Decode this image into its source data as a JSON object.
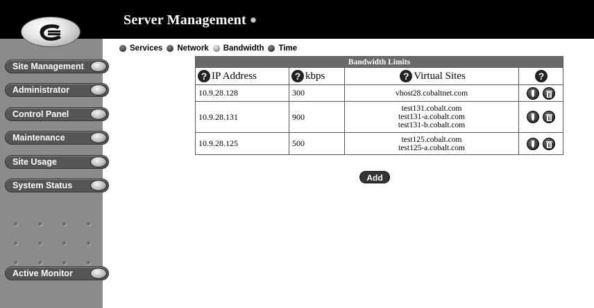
{
  "header": {
    "title": "Server Management"
  },
  "sidebar": {
    "items": [
      {
        "label": "Site Management"
      },
      {
        "label": "Administrator"
      },
      {
        "label": "Control Panel"
      },
      {
        "label": "Maintenance"
      },
      {
        "label": "Site Usage"
      },
      {
        "label": "System Status"
      },
      {
        "label": "Active Monitor"
      }
    ]
  },
  "tabs": [
    {
      "label": "Services"
    },
    {
      "label": "Network"
    },
    {
      "label": "Bandwidth"
    },
    {
      "label": "Time"
    }
  ],
  "table": {
    "caption": "Bandwidth Limits",
    "columns": [
      "IP Address",
      "kbps",
      "Virtual Sites"
    ],
    "rows": [
      {
        "ip": "10.9.28.128",
        "kbps": "300",
        "sites": [
          "vhost28.cobaltnet.com"
        ]
      },
      {
        "ip": "10.9.28.131",
        "kbps": "900",
        "sites": [
          "test131.cobalt.com",
          "test131-a.cobalt.com",
          "test131-b.cobalt.com"
        ]
      },
      {
        "ip": "10.9.28.125",
        "kbps": "500",
        "sites": [
          "test125.cobalt.com",
          "test125-a.cobalt.com"
        ]
      }
    ]
  },
  "add_label": "Add",
  "icons": {
    "help": "?",
    "row_actions": [
      "edit-icon",
      "trash-icon"
    ]
  },
  "colors": {
    "header_bg": "#000000",
    "sidebar_bg": "#8b8b8b",
    "caption_bg": "#6a6a6a"
  }
}
